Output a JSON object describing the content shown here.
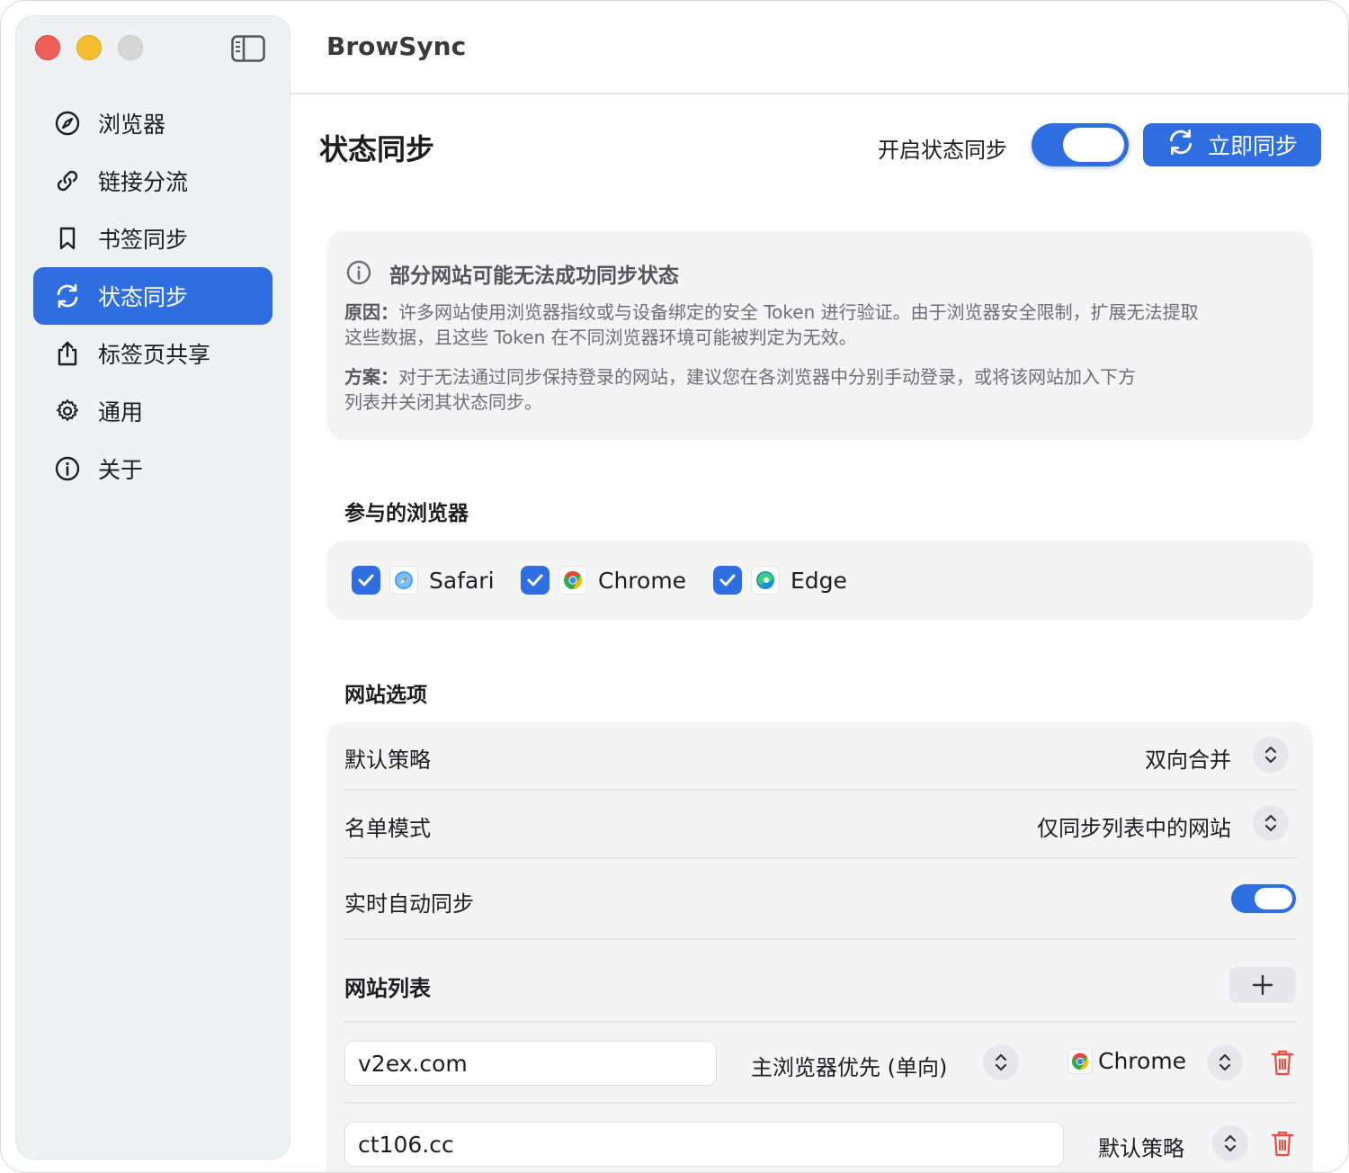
{
  "app": {
    "title": "BrowSync"
  },
  "sidebar": {
    "items": [
      {
        "label": "浏览器",
        "icon": "compass-icon"
      },
      {
        "label": "链接分流",
        "icon": "link-icon"
      },
      {
        "label": "书签同步",
        "icon": "bookmark-icon"
      },
      {
        "label": "状态同步",
        "icon": "sync-icon",
        "active": true
      },
      {
        "label": "标签页共享",
        "icon": "share-icon"
      },
      {
        "label": "通用",
        "icon": "gear-icon"
      },
      {
        "label": "关于",
        "icon": "info-icon"
      }
    ]
  },
  "header": {
    "page_title": "状态同步",
    "toggle_label": "开启状态同步",
    "toggle_on": true,
    "sync_now_label": "立即同步"
  },
  "notice": {
    "title": "部分网站可能无法成功同步状态",
    "reason_label": "原因：",
    "reason_line1": "许多网站使用浏览器指纹或与设备绑定的安全 Token 进行验证。由于浏览器安全限制，扩展无法提取",
    "reason_line2": "这些数据，且这些 Token 在不同浏览器环境可能被判定为无效。",
    "solution_label": "方案：",
    "solution_line1": "对于无法通过同步保持登录的网站，建议您在各浏览器中分别手动登录，或将该网站加入下方",
    "solution_line2": "列表并关闭其状态同步。"
  },
  "browsers": {
    "section_title": "参与的浏览器",
    "items": [
      {
        "name": "Safari",
        "checked": true
      },
      {
        "name": "Chrome",
        "checked": true
      },
      {
        "name": "Edge",
        "checked": true
      }
    ]
  },
  "site_options": {
    "section_title": "网站选项",
    "default_policy_label": "默认策略",
    "default_policy_value": "双向合并",
    "list_mode_label": "名单模式",
    "list_mode_value": "仅同步列表中的网站",
    "realtime_label": "实时自动同步",
    "realtime_on": true,
    "site_list_label": "网站列表",
    "sites": [
      {
        "domain": "v2ex.com",
        "policy": "主浏览器优先 (单向)",
        "browser": "Chrome"
      },
      {
        "domain": "ct106.cc",
        "policy": "默认策略"
      }
    ]
  },
  "colors": {
    "accent": "#2e6ee0",
    "danger": "#ee4b43"
  }
}
